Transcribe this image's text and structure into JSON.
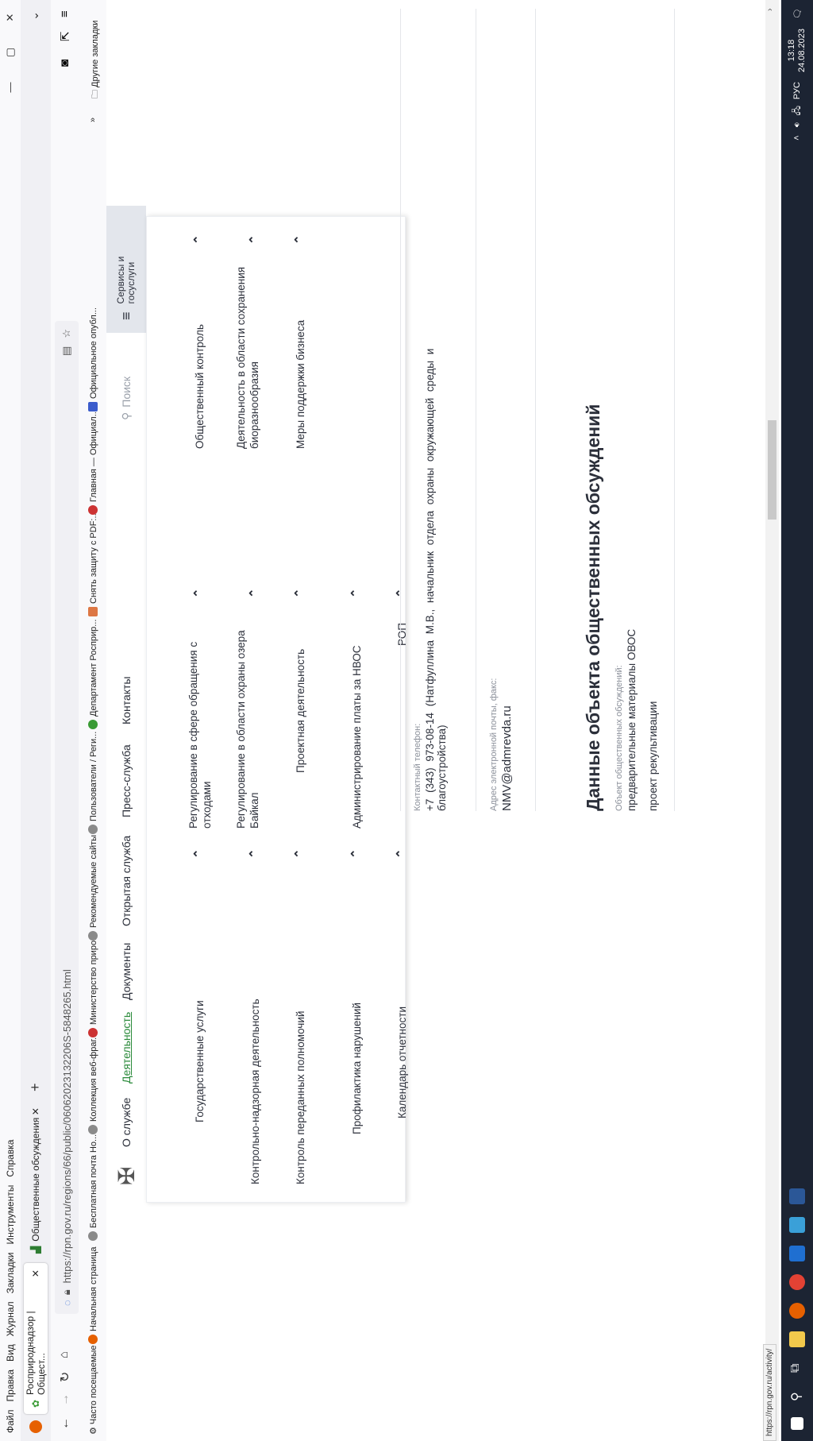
{
  "menubar": {
    "items": [
      "Файл",
      "Правка",
      "Вид",
      "Журнал",
      "Закладки",
      "Инструменты",
      "Справка"
    ]
  },
  "tabs": [
    {
      "title": "Росприроднадзор | Общест...",
      "active": true
    },
    {
      "title": "Общественные обсуждения",
      "active": false
    }
  ],
  "nav": {
    "url": "https://rpn.gov.ru/regions/66/public/06062023132206S-5848265.html"
  },
  "bookmarks": [
    "Часто посещаемые",
    "Начальная страница",
    "Бесплатная почта Ho...",
    "Коллекция веб-фраг...",
    "Министерство приро...",
    "Рекомендуемые сайты",
    "Пользователи / Реги...",
    "Департамент Росприр...",
    "Снять защиту с PDF:...",
    "Главная — Официал...",
    "Официальное опубл...",
    "Другие закладки"
  ],
  "site_nav": {
    "items": [
      "О службе",
      "Деятельность",
      "Документы",
      "Открытая служба",
      "Пресс-служба",
      "Контакты"
    ],
    "active": "Деятельность",
    "search_placeholder": "Поиск",
    "services_label_1": "Сервисы и",
    "services_label_2": "госуслуги"
  },
  "dropdown": {
    "col1": [
      "Государственные услуги",
      "Контрольно-надзорная деятельность",
      "Контроль переданных полномочий",
      "Профилактика нарушений",
      "Календарь отчетности"
    ],
    "col2": [
      [
        "Регулирование в сфере обращения с",
        "отходами"
      ],
      [
        "Регулирование в области охраны озера",
        "Байкал"
      ],
      [
        "Проектная деятельность"
      ],
      [
        "Администрирование платы за НВОС"
      ],
      [
        "РОП"
      ]
    ],
    "col3": [
      [
        "Общественный контроль"
      ],
      [
        "Деятельность в области сохранения",
        "биоразнообразия"
      ],
      [
        "Меры поддержки бизнеса"
      ]
    ]
  },
  "contacts": {
    "phone_label": "Контактный телефон:",
    "phone_line1": "+7 (343) 973-08-14 (Натфуллина М.В., начальник отдела охраны окружающей среды и",
    "phone_line2": "благоустройства)",
    "email_label": "Адрес электронной почты, факс:",
    "email": "NMV@admrevda.ru",
    "section_title": "Данные объекта общественных обсуждений",
    "object_label": "Объект общественных обсуждений:",
    "object_line1": "предварительные материалы ОВОС",
    "object_line2": "проект рекультивации"
  },
  "status_url": "https://rpn.gov.ru/activity/",
  "tray": {
    "lang": "РУС",
    "time": "13:18",
    "date": "24.08.2023"
  }
}
